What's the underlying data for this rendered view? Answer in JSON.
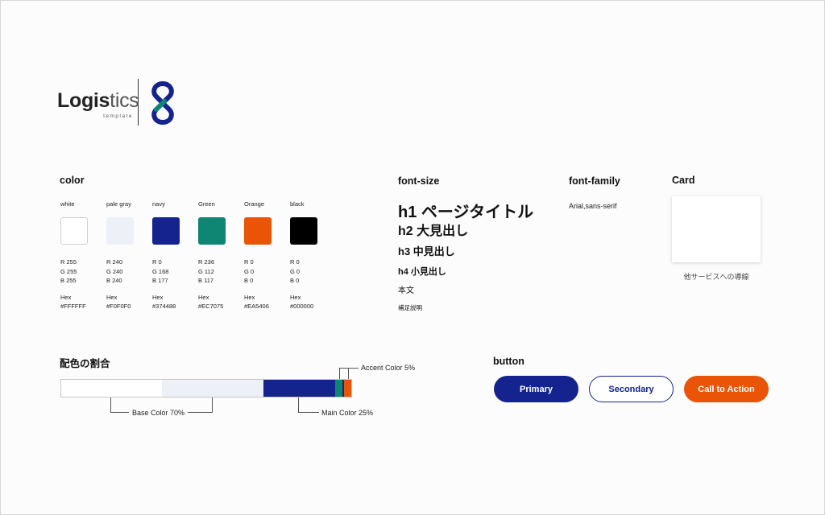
{
  "logo": {
    "word_bold": "Logis",
    "word_light": "tics",
    "subtitle": "template"
  },
  "sections": {
    "color": "color",
    "font_size": "font-size",
    "font_family": "font-family",
    "card": "Card",
    "ratio": "配色の割合",
    "button": "button"
  },
  "colors": [
    {
      "name": "white",
      "r": "R 255",
      "g": "G 255",
      "b": "B 255",
      "hex_label": "Hex",
      "hex": "#FFFFFF",
      "swatch": "#FFFFFF"
    },
    {
      "name": "pale gray",
      "r": "R 240",
      "g": "G 240",
      "b": "B 240",
      "hex_label": "Hex",
      "hex": "#F0F0F0",
      "swatch": "#EEF0F7"
    },
    {
      "name": "navy",
      "r": "R 0",
      "g": "G 168",
      "b": "B 177",
      "hex_label": "Hex",
      "hex": "#374488",
      "swatch": "#14238E"
    },
    {
      "name": "Green",
      "r": "R 236",
      "g": "G 112",
      "b": "B 117",
      "hex_label": "Hex",
      "hex": "#EC7075",
      "swatch": "#0E8673"
    },
    {
      "name": "Orange",
      "r": "R 0",
      "g": "G 0",
      "b": "B 0",
      "hex_label": "Hex",
      "hex": "#EA5406",
      "swatch": "#EA5406"
    },
    {
      "name": "black",
      "r": "R 0",
      "g": "G 0",
      "b": "B 0",
      "hex_label": "Hex",
      "hex": "#000000",
      "swatch": "#000000"
    }
  ],
  "font_sizes": {
    "h1": "h1 ページタイトル",
    "h2": "h2 大見出し",
    "h3": "h3 中見出し",
    "h4": "h4 小見出し",
    "body": "本文",
    "note": "補足説明"
  },
  "font_family": "Arial,sans-serif",
  "card": {
    "caption": "他サービスへの導線"
  },
  "ratio": {
    "segments": [
      {
        "label": "Base Color 70%",
        "percent": 70,
        "colors": [
          "#FFFFFF",
          "#EEF0F7"
        ]
      },
      {
        "label": "Main Color 25%",
        "percent": 25,
        "colors": [
          "#14238E"
        ]
      },
      {
        "label": "Accent Color 5%",
        "percent": 5,
        "colors": [
          "#0E8673",
          "#14238E",
          "#EA5406"
        ]
      }
    ]
  },
  "buttons": {
    "primary": "Primary",
    "secondary": "Secondary",
    "cta": "Call to Action"
  },
  "palette": {
    "navy": "#14238E",
    "green": "#0E8673",
    "orange": "#EA5406",
    "pale": "#EEF0F7"
  }
}
